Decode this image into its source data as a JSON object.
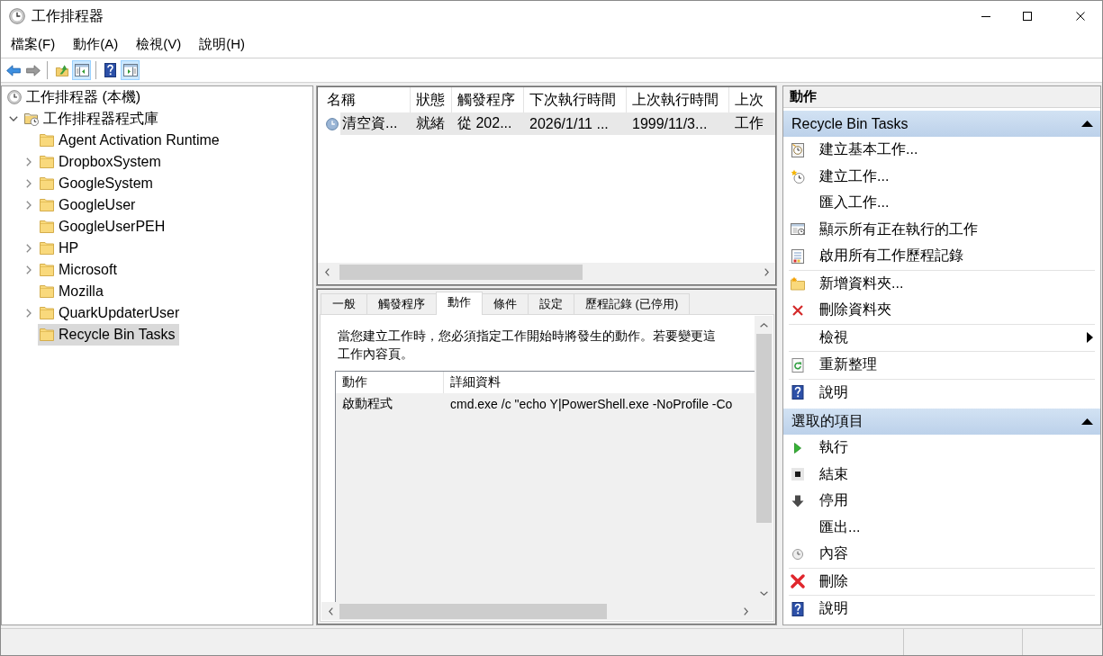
{
  "window": {
    "title": "工作排程器"
  },
  "menu": [
    {
      "label": "檔案(F)"
    },
    {
      "label": "動作(A)"
    },
    {
      "label": "檢視(V)"
    },
    {
      "label": "說明(H)"
    }
  ],
  "toolbar": {
    "console_tree_shown": true,
    "action_pane_shown": true
  },
  "tree": {
    "label": "工作排程器 (本機)",
    "selected": false,
    "children": [
      {
        "label": "工作排程器程式庫",
        "selected": false,
        "expanded": true,
        "children": [
          {
            "label": "Agent Activation Runtime",
            "selected": false,
            "expandable": false,
            "expanded": false
          },
          {
            "label": "DropboxSystem",
            "selected": false,
            "expandable": true,
            "expanded": false
          },
          {
            "label": "GoogleSystem",
            "selected": false,
            "expandable": true,
            "expanded": false
          },
          {
            "label": "GoogleUser",
            "selected": false,
            "expandable": true,
            "expanded": false
          },
          {
            "label": "GoogleUserPEH",
            "selected": false,
            "expandable": false,
            "expanded": false
          },
          {
            "label": "HP",
            "selected": false,
            "expandable": true,
            "expanded": false
          },
          {
            "label": "Microsoft",
            "selected": false,
            "expandable": true,
            "expanded": false
          },
          {
            "label": "Mozilla",
            "selected": false,
            "expandable": false,
            "expanded": false
          },
          {
            "label": "QuarkUpdaterUser",
            "selected": false,
            "expandable": true,
            "expanded": false
          },
          {
            "label": "Recycle Bin Tasks",
            "selected": true,
            "expandable": false,
            "expanded": false
          }
        ]
      }
    ]
  },
  "task_list": {
    "columns": [
      "名稱",
      "狀態",
      "觸發程序",
      "下次執行時間",
      "上次執行時間",
      "上次"
    ],
    "rows": [
      {
        "selected": true,
        "cells": [
          "清空資...",
          "就緒",
          "從 202...",
          "2026/1/11 ...",
          "1999/11/3...",
          "工作"
        ]
      }
    ]
  },
  "detail_tabs": [
    {
      "label": "一般",
      "selected": false
    },
    {
      "label": "觸發程序",
      "selected": false
    },
    {
      "label": "動作",
      "selected": true
    },
    {
      "label": "條件",
      "selected": false
    },
    {
      "label": "設定",
      "selected": false
    },
    {
      "label": "歷程記錄 (已停用)",
      "selected": false
    }
  ],
  "actions_tab": {
    "description_lines": [
      "當您建立工作時，您必須指定工作開始時將發生的動作。若要變更這",
      "工作內容頁。"
    ],
    "table": {
      "columns": [
        "動作",
        "詳細資料"
      ],
      "rows": [
        {
          "cells": [
            "啟動程式",
            "cmd.exe /c \"echo Y|PowerShell.exe -NoProfile -Co"
          ]
        }
      ]
    }
  },
  "actions_pane": {
    "title": "動作",
    "sections": [
      {
        "title": "Recycle Bin Tasks",
        "expanded": true,
        "groups": [
          {
            "items": [
              {
                "label": "建立基本工作...",
                "kind": "wizard"
              },
              {
                "label": "建立工作...",
                "kind": "newtask"
              },
              {
                "label": "匯入工作...",
                "kind": "plain"
              },
              {
                "label": "顯示所有正在執行的工作",
                "kind": "running"
              },
              {
                "label": "啟用所有工作歷程記錄",
                "kind": "history"
              }
            ]
          },
          {
            "items": [
              {
                "label": "新增資料夾...",
                "kind": "newfolder"
              },
              {
                "label": "刪除資料夾",
                "kind": "delfolder"
              }
            ]
          },
          {
            "items": [
              {
                "label": "檢視",
                "kind": "submenu"
              }
            ]
          },
          {
            "items": [
              {
                "label": "重新整理",
                "kind": "refresh"
              }
            ]
          },
          {
            "items": [
              {
                "label": "說明",
                "kind": "help"
              }
            ]
          }
        ]
      },
      {
        "title": "選取的項目",
        "expanded": true,
        "groups": [
          {
            "items": [
              {
                "label": "執行",
                "kind": "run"
              },
              {
                "label": "結束",
                "kind": "end"
              },
              {
                "label": "停用",
                "kind": "disable"
              },
              {
                "label": "匯出...",
                "kind": "plain"
              },
              {
                "label": "內容",
                "kind": "properties"
              }
            ]
          },
          {
            "items": [
              {
                "label": "刪除",
                "kind": "delete"
              }
            ]
          },
          {
            "items": [
              {
                "label": "說明",
                "kind": "help"
              }
            ]
          }
        ]
      }
    ]
  }
}
